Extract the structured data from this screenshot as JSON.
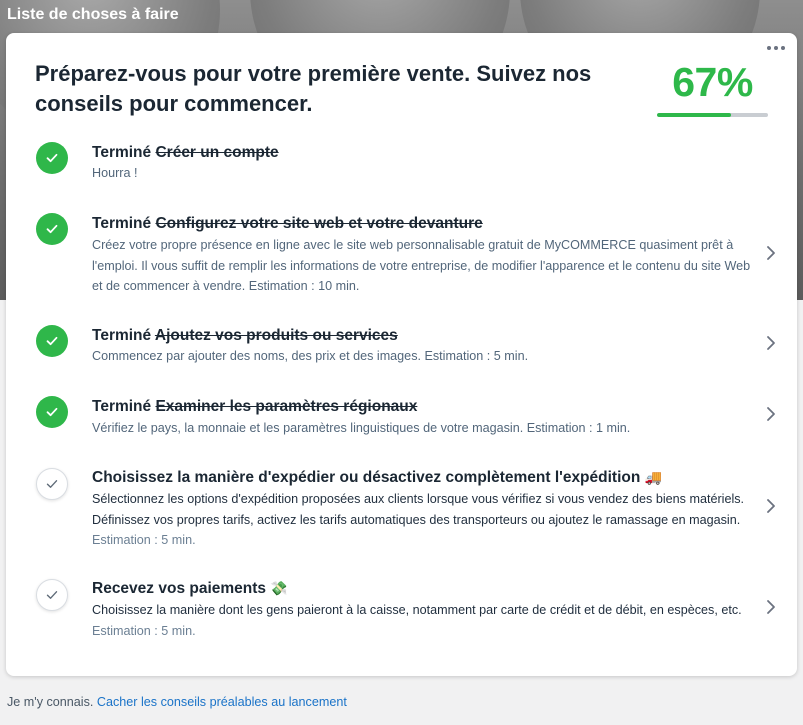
{
  "page": {
    "title": "Liste de choses à faire"
  },
  "card": {
    "headline": "Préparez-vous pour votre première vente. Suivez nos conseils pour commencer.",
    "progress": {
      "percent_label": "67%",
      "fraction": 0.67
    },
    "accent_color": "#2eb84a"
  },
  "tasks": [
    {
      "status": "done",
      "done_prefix": "Terminé",
      "title": "Créer un compte",
      "description": "Hourra !",
      "estimate": "",
      "has_chevron": false
    },
    {
      "status": "done",
      "done_prefix": "Terminé",
      "title": "Configurez votre site web et votre devanture",
      "description": "Créez votre propre présence en ligne avec le site web personnalisable gratuit de MyCOMMERCE quasiment prêt à l'emploi. Il vous suffit de remplir les informations de votre entreprise, de modifier l'apparence et le contenu du site Web et de commencer à vendre. Estimation : 10 min.",
      "estimate": "",
      "has_chevron": true
    },
    {
      "status": "done",
      "done_prefix": "Terminé",
      "title": "Ajoutez vos produits ou services",
      "description": "Commencez par ajouter des noms, des prix et des images. Estimation : 5 min.",
      "estimate": "",
      "has_chevron": true
    },
    {
      "status": "done",
      "done_prefix": "Terminé",
      "title": "Examiner les paramètres régionaux",
      "description": "Vérifiez le pays, la monnaie et les paramètres linguistiques de votre magasin. Estimation : 1 min.",
      "estimate": "",
      "has_chevron": true
    },
    {
      "status": "todo",
      "done_prefix": "",
      "title": "Choisissez la manière d'expédier ou désactivez complètement l'expédition",
      "title_emoji": "🚚",
      "description": "Sélectionnez les options d'expédition proposées aux clients lorsque vous vérifiez si vous vendez des biens matériels. Définissez vos propres tarifs, activez les tarifs automatiques des transporteurs ou ajoutez le ramassage en magasin.",
      "estimate": "Estimation : 5 min.",
      "has_chevron": true
    },
    {
      "status": "todo",
      "done_prefix": "",
      "title": "Recevez vos paiements",
      "title_emoji": "💸",
      "description": "Choisissez la manière dont les gens paieront à la caisse, notamment par carte de crédit et de débit, en espèces, etc.",
      "estimate": "Estimation : 5 min.",
      "has_chevron": true
    }
  ],
  "footer": {
    "prefix": "Je m'y connais.",
    "link": "Cacher les conseils préalables au lancement"
  },
  "icons": {
    "menu": "more-horizontal-icon",
    "done": "check-circle-icon",
    "todo": "check-outline-icon",
    "chevron": "chevron-right-icon"
  }
}
